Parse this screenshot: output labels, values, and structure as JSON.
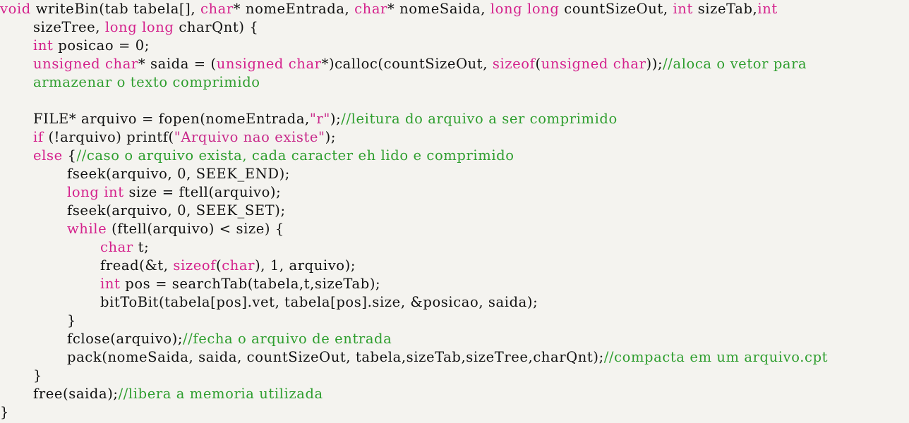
{
  "colors": {
    "background": "#f4f3ef",
    "text": "#111111",
    "keyword": "#d4218c",
    "comment": "#2e9e2e",
    "string": "#c8288a"
  },
  "code": {
    "lines": [
      [
        {
          "t": "kw",
          "s": "void"
        },
        {
          "t": "tx",
          "s": " writeBin(tab tabela[], "
        },
        {
          "t": "kw",
          "s": "char"
        },
        {
          "t": "tx",
          "s": "* nomeEntrada, "
        },
        {
          "t": "kw",
          "s": "char"
        },
        {
          "t": "tx",
          "s": "* nomeSaida, "
        },
        {
          "t": "kw",
          "s": "long long"
        },
        {
          "t": "tx",
          "s": " countSizeOut, "
        },
        {
          "t": "kw",
          "s": "int"
        },
        {
          "t": "tx",
          "s": " sizeTab,"
        },
        {
          "t": "kw",
          "s": "int"
        }
      ],
      [
        {
          "t": "tx",
          "s": "sizeTree, "
        },
        {
          "t": "kw",
          "s": "long long"
        },
        {
          "t": "tx",
          "s": " charQnt) {"
        }
      ],
      [
        {
          "t": "kw",
          "s": "int"
        },
        {
          "t": "tx",
          "s": " posicao = 0;"
        }
      ],
      [
        {
          "t": "kw",
          "s": "unsigned char"
        },
        {
          "t": "tx",
          "s": "* saida = ("
        },
        {
          "t": "kw",
          "s": "unsigned char"
        },
        {
          "t": "tx",
          "s": "*)calloc(countSizeOut, "
        },
        {
          "t": "kw",
          "s": "sizeof"
        },
        {
          "t": "tx",
          "s": "("
        },
        {
          "t": "kw",
          "s": "unsigned char"
        },
        {
          "t": "tx",
          "s": "));"
        },
        {
          "t": "cm",
          "s": "//aloca o vetor para"
        }
      ],
      [
        {
          "t": "cm",
          "s": "armazenar o texto comprimido"
        }
      ],
      [],
      [
        {
          "t": "tx",
          "s": "FILE* arquivo = fopen(nomeEntrada,"
        },
        {
          "t": "st",
          "s": "\"r\""
        },
        {
          "t": "tx",
          "s": ");"
        },
        {
          "t": "cm",
          "s": "//leitura do arquivo a ser comprimido"
        }
      ],
      [
        {
          "t": "kw",
          "s": "if"
        },
        {
          "t": "tx",
          "s": " (!arquivo) printf("
        },
        {
          "t": "st",
          "s": "\"Arquivo nao existe\""
        },
        {
          "t": "tx",
          "s": ");"
        }
      ],
      [
        {
          "t": "kw",
          "s": "else"
        },
        {
          "t": "tx",
          "s": " {"
        },
        {
          "t": "cm",
          "s": "//caso o arquivo exista, cada caracter eh lido e comprimido"
        }
      ],
      [
        {
          "t": "tx",
          "s": "fseek(arquivo, 0, SEEK_END);"
        }
      ],
      [
        {
          "t": "kw",
          "s": "long int"
        },
        {
          "t": "tx",
          "s": " size = ftell(arquivo);"
        }
      ],
      [
        {
          "t": "tx",
          "s": "fseek(arquivo, 0, SEEK_SET);"
        }
      ],
      [
        {
          "t": "kw",
          "s": "while"
        },
        {
          "t": "tx",
          "s": " (ftell(arquivo) < size) {"
        }
      ],
      [
        {
          "t": "kw",
          "s": "char"
        },
        {
          "t": "tx",
          "s": " t;"
        }
      ],
      [
        {
          "t": "tx",
          "s": "fread(&t, "
        },
        {
          "t": "kw",
          "s": "sizeof"
        },
        {
          "t": "tx",
          "s": "("
        },
        {
          "t": "kw",
          "s": "char"
        },
        {
          "t": "tx",
          "s": "), 1, arquivo);"
        }
      ],
      [
        {
          "t": "kw",
          "s": "int"
        },
        {
          "t": "tx",
          "s": " pos = searchTab(tabela,t,sizeTab);"
        }
      ],
      [
        {
          "t": "tx",
          "s": "bitToBit(tabela[pos].vet, tabela[pos].size, &posicao, saida);"
        }
      ],
      [
        {
          "t": "tx",
          "s": "}"
        }
      ],
      [
        {
          "t": "tx",
          "s": "fclose(arquivo);"
        },
        {
          "t": "cm",
          "s": "//fecha o arquivo de entrada"
        }
      ],
      [
        {
          "t": "tx",
          "s": "pack(nomeSaida, saida, countSizeOut, tabela,sizeTab,sizeTree,charQnt);"
        },
        {
          "t": "cm",
          "s": "//compacta em um arquivo.cpt"
        }
      ],
      [
        {
          "t": "tx",
          "s": "}"
        }
      ],
      [
        {
          "t": "tx",
          "s": "free(saida);"
        },
        {
          "t": "cm",
          "s": "//libera a memoria utilizada"
        }
      ],
      [
        {
          "t": "tx",
          "s": "}"
        }
      ]
    ]
  }
}
